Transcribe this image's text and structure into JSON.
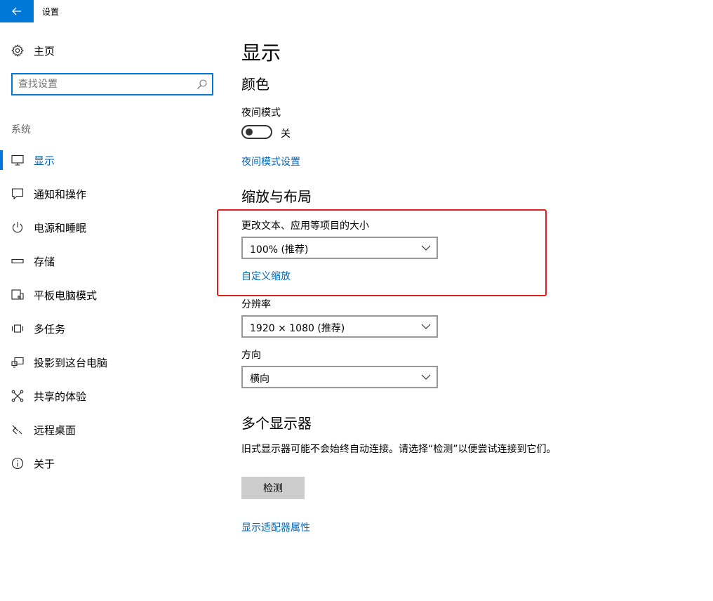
{
  "window": {
    "title": "设置"
  },
  "sidebar": {
    "home_label": "主页",
    "search": {
      "placeholder": "查找设置",
      "value": ""
    },
    "section_label": "系统",
    "items": [
      {
        "label": "显示",
        "icon": "monitor-icon",
        "active": true
      },
      {
        "label": "通知和操作",
        "icon": "notification-icon",
        "active": false
      },
      {
        "label": "电源和睡眠",
        "icon": "power-icon",
        "active": false
      },
      {
        "label": "存储",
        "icon": "storage-icon",
        "active": false
      },
      {
        "label": "平板电脑模式",
        "icon": "tablet-mode-icon",
        "active": false
      },
      {
        "label": "多任务",
        "icon": "multitasking-icon",
        "active": false
      },
      {
        "label": "投影到这台电脑",
        "icon": "project-icon",
        "active": false
      },
      {
        "label": "共享的体验",
        "icon": "shared-experiences-icon",
        "active": false
      },
      {
        "label": "远程桌面",
        "icon": "remote-desktop-icon",
        "active": false
      },
      {
        "label": "关于",
        "icon": "info-icon",
        "active": false
      }
    ]
  },
  "main": {
    "page_title": "显示",
    "color": {
      "heading": "颜色",
      "night_light_label": "夜间模式",
      "night_light_state": "关",
      "night_light_settings_link": "夜间模式设置"
    },
    "scale_layout": {
      "heading": "缩放与布局",
      "text_size_label": "更改文本、应用等项目的大小",
      "text_size_value": "100% (推荐)",
      "custom_scaling_link": "自定义缩放",
      "resolution_label": "分辨率",
      "resolution_value": "1920 × 1080 (推荐)",
      "orientation_label": "方向",
      "orientation_value": "横向"
    },
    "multiple_displays": {
      "heading": "多个显示器",
      "description": "旧式显示器可能不会始终自动连接。请选择“检测”以便尝试连接到它们。",
      "detect_button": "检测",
      "adapter_properties_link": "显示适配器属性"
    }
  },
  "colors": {
    "accent": "#0078d7",
    "link": "#0067b8",
    "highlight_box": "#e02020",
    "button_gray": "#cccccc"
  }
}
